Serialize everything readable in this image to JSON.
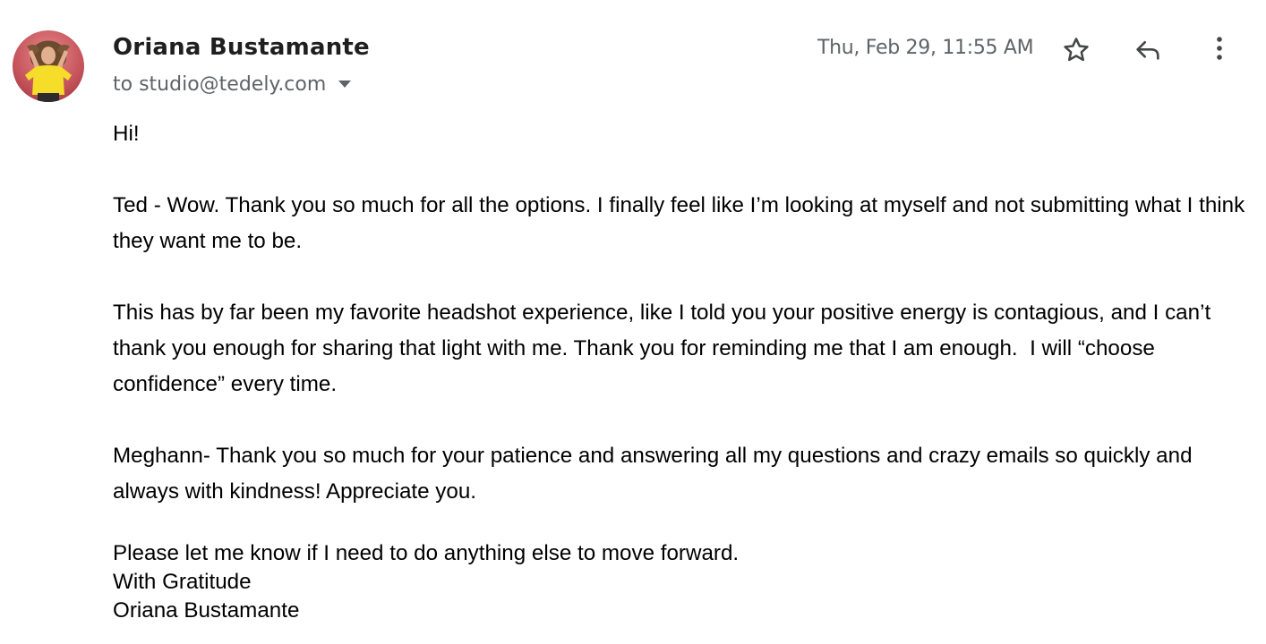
{
  "email": {
    "sender": {
      "name": "Oriana Bustamante",
      "avatar_icon": "profile-photo",
      "avatar_bg": "#c4525a",
      "avatar_shirt": "#f6dd2a"
    },
    "recipient": {
      "prefix": "to",
      "address": "studio@tedely.com",
      "caret_icon": "caret-down-icon"
    },
    "date": "Thu, Feb 29, 11:55 AM",
    "actions": {
      "star_icon": "star-outline-icon",
      "reply_icon": "reply-arrow-icon",
      "more_icon": "vertical-dots-icon"
    },
    "body": {
      "greeting": "Hi!",
      "paragraphs": [
        "Ted - Wow. Thank you so much for all the options. I finally feel like I’m looking at myself and not submitting what I think they want me to be.",
        "This has by far been my favorite headshot experience, like I told you your positive energy is contagious, and I can’t thank you enough for sharing that light with me. Thank you for reminding me that I am enough.  I will “choose confidence” every time.",
        "Meghann- Thank you so much for your patience and answering all my questions and crazy emails so quickly and always with kindness! Appreciate you."
      ],
      "closing": [
        "Please let me know if I need to do anything else to move forward.",
        "With Gratitude",
        "Oriana Bustamante"
      ]
    }
  },
  "colors": {
    "name_text": "#1f1f1f",
    "meta_text": "#5f6368",
    "icon": "#444746",
    "body_text": "#000000"
  }
}
